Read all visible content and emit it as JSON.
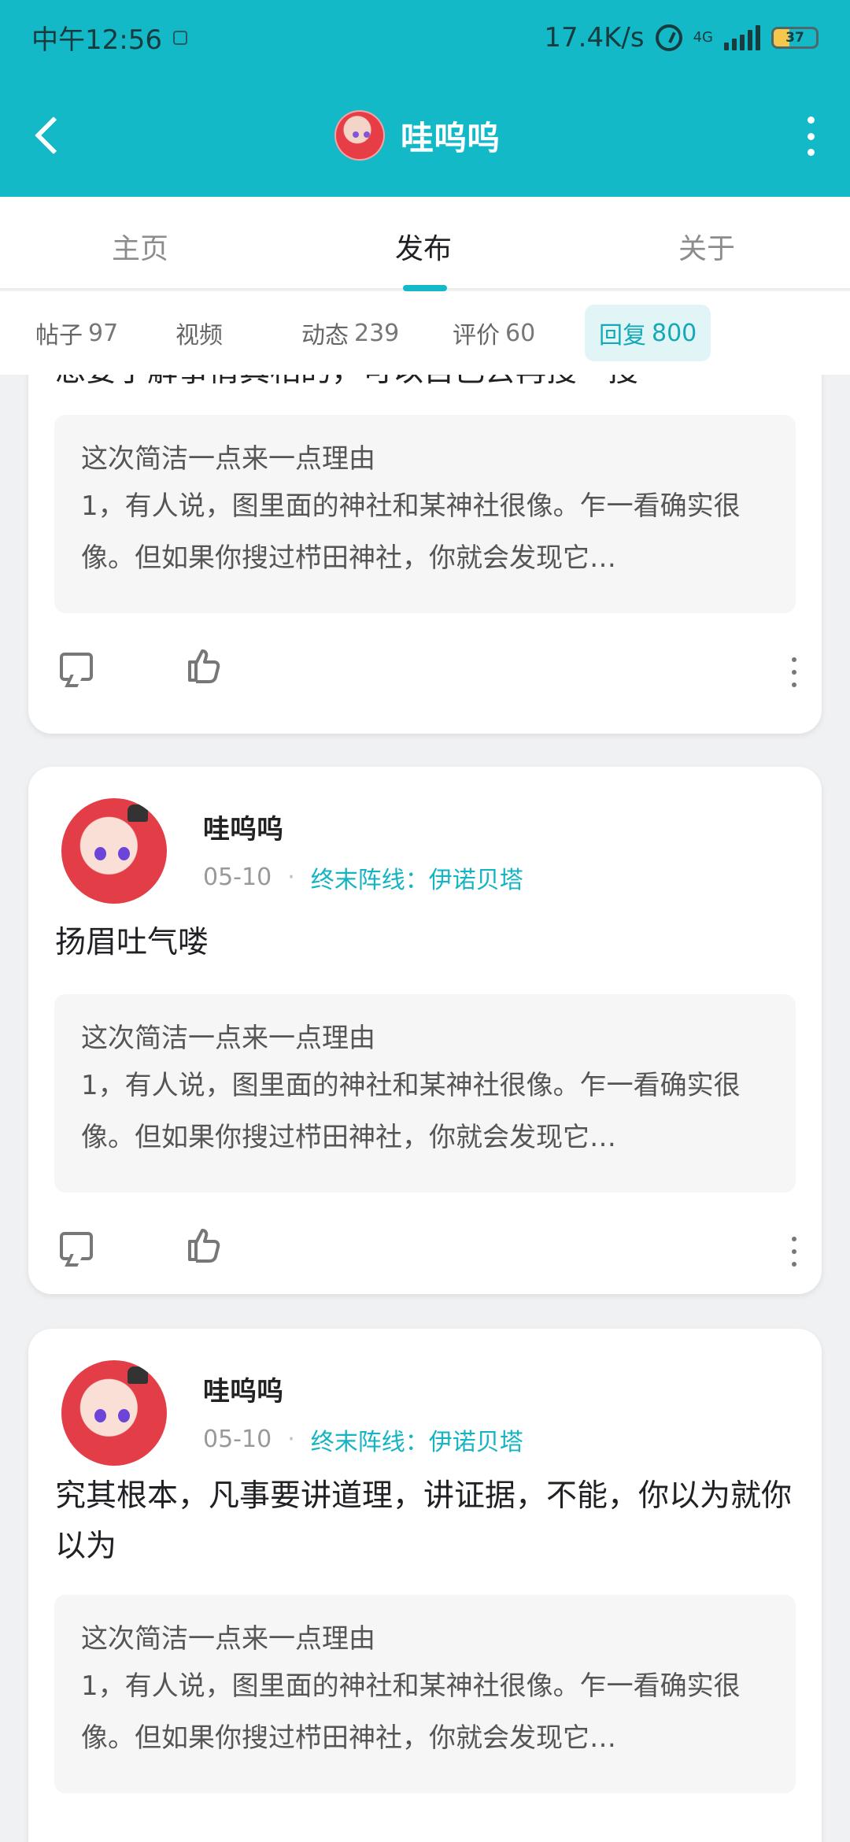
{
  "status_bar": {
    "time": "中午12:56",
    "network_speed": "17.4K/s",
    "network_type": "4G",
    "battery": "37",
    "battery_level": 0.37
  },
  "header": {
    "title": "哇呜呜",
    "accent_color": "#14b9c8"
  },
  "tabs": [
    {
      "label": "主页"
    },
    {
      "label": "发布"
    },
    {
      "label": "关于"
    }
  ],
  "subtabs": [
    {
      "label": "帖子",
      "count": "97"
    },
    {
      "label": "视频",
      "count": ""
    },
    {
      "label": "动态",
      "count": "239"
    },
    {
      "label": "评价",
      "count": "60"
    },
    {
      "label": "回复",
      "count": "800"
    }
  ],
  "posts": [
    {
      "text": "想要了解事情真相的，可以自己去再搜一搜",
      "quote_title": "这次简洁一点来一点理由",
      "quote_body": "1，有人说，图里面的神社和某神社很像。乍一看确实很像。但如果你搜过栉田神社，你就会发现它…"
    },
    {
      "username": "哇呜呜",
      "date": "05-10",
      "game": "终末阵线：伊诺贝塔",
      "text": "扬眉吐气喽",
      "quote_title": "这次简洁一点来一点理由",
      "quote_body": "1，有人说，图里面的神社和某神社很像。乍一看确实很像。但如果你搜过栉田神社，你就会发现它…"
    },
    {
      "username": "哇呜呜",
      "date": "05-10",
      "game": "终末阵线：伊诺贝塔",
      "text": "究其根本，凡事要讲道理，讲证据，不能，你以为就你以为",
      "quote_title": "这次简洁一点来一点理由",
      "quote_body": "1，有人说，图里面的神社和某神社很像。乍一看确实很像。但如果你搜过栉田神社，你就会发现它…"
    }
  ]
}
